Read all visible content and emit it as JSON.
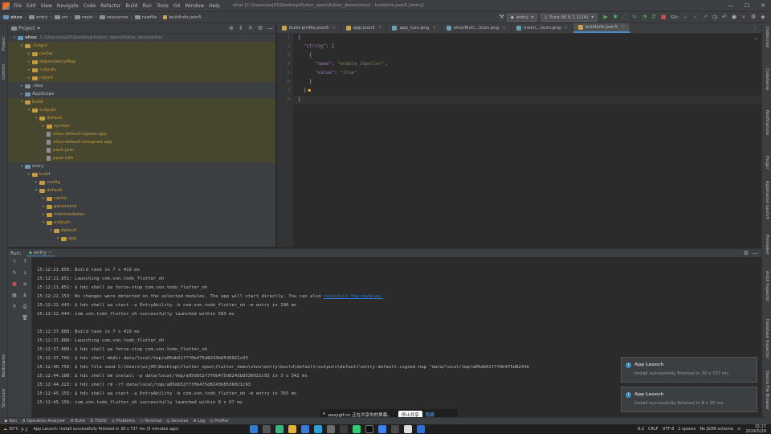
{
  "menubar": {
    "items": [
      "File",
      "Edit",
      "View",
      "Navigate",
      "Code",
      "Refactor",
      "Build",
      "Run",
      "Tools",
      "Git",
      "Window",
      "Help"
    ],
    "title": "ohos [C:\\Users\\wsj05\\Desktop\\flutter_open\\flutter_demo\\ohos] - buildinfo.json5 [entry]"
  },
  "breadcrumb": [
    "ohos",
    "entry",
    "src",
    "main",
    "resources",
    "rawfile",
    "buildinfo.json5"
  ],
  "toolbar": {
    "module": "entry",
    "device": "Pura 90 6.1.1(24)",
    "git_label": "Git:"
  },
  "project": {
    "header": "Project",
    "root_name": "ohos",
    "root_path": "C:\\Users\\wsj05\\Desktop\\flutter_open\\flutter_demo\\ohos",
    "tree": [
      {
        "label": ".hvigor",
        "level": 1,
        "kind": "folder-o",
        "arrow": "▾",
        "ex": true
      },
      {
        "label": "cache",
        "level": 2,
        "kind": "folder-o",
        "arrow": "▸",
        "ex": true
      },
      {
        "label": "dependencyMap",
        "level": 2,
        "kind": "folder-o",
        "arrow": "▸",
        "ex": true
      },
      {
        "label": "outputs",
        "level": 2,
        "kind": "folder-o",
        "arrow": "▸",
        "ex": true
      },
      {
        "label": "report",
        "level": 2,
        "kind": "folder-o",
        "arrow": "▸",
        "ex": true
      },
      {
        "label": ".idea",
        "level": 1,
        "kind": "folder",
        "arrow": "▸",
        "ex": false
      },
      {
        "label": "AppScope",
        "level": 1,
        "kind": "folder-n",
        "arrow": "▸",
        "ex": false
      },
      {
        "label": "build",
        "level": 1,
        "kind": "folder-o",
        "arrow": "▾",
        "ex": true
      },
      {
        "label": "outputs",
        "level": 2,
        "kind": "folder-o",
        "arrow": "▾",
        "ex": true
      },
      {
        "label": "default",
        "level": 3,
        "kind": "folder-o",
        "arrow": "▾",
        "ex": true
      },
      {
        "label": "symbol",
        "level": 4,
        "kind": "folder-o",
        "arrow": "▸",
        "ex": true
      },
      {
        "label": "ohos-default-signed.app",
        "level": 4,
        "kind": "file-o",
        "arrow": "",
        "ex": true
      },
      {
        "label": "ohos-default-unsigned.app",
        "level": 4,
        "kind": "file-o",
        "arrow": "",
        "ex": true
      },
      {
        "label": "pack.json",
        "level": 4,
        "kind": "file-o",
        "arrow": "",
        "ex": true
      },
      {
        "label": "pack.info",
        "level": 4,
        "kind": "file-o",
        "arrow": "",
        "ex": true
      },
      {
        "label": "entry",
        "level": 1,
        "kind": "folder-n",
        "arrow": "▾",
        "ex": false
      },
      {
        "label": "build",
        "level": 2,
        "kind": "folder-o",
        "arrow": "▾",
        "ex": false
      },
      {
        "label": "config",
        "level": 3,
        "kind": "folder-o",
        "arrow": "▸",
        "ex": false
      },
      {
        "label": "default",
        "level": 3,
        "kind": "folder-o",
        "arrow": "▾",
        "ex": false
      },
      {
        "label": "cache",
        "level": 4,
        "kind": "folder-o",
        "arrow": "▸",
        "ex": false
      },
      {
        "label": "generated",
        "level": 4,
        "kind": "folder-o",
        "arrow": "▸",
        "ex": false
      },
      {
        "label": "intermediates",
        "level": 4,
        "kind": "folder-o",
        "arrow": "▸",
        "ex": false
      },
      {
        "label": "outputs",
        "level": 4,
        "kind": "folder-o",
        "arrow": "▾",
        "ex": false
      },
      {
        "label": "default",
        "level": 5,
        "kind": "folder-o",
        "arrow": "▾",
        "ex": false
      },
      {
        "label": "app",
        "level": 6,
        "kind": "folder-o",
        "arrow": "▾",
        "ex": false
      }
    ]
  },
  "editor": {
    "tabs": [
      {
        "label": "build-profile.json5",
        "color": "#c9a44a",
        "active": false
      },
      {
        "label": "app.json5",
        "color": "#c9a44a",
        "active": false
      },
      {
        "label": "app_icon.png",
        "color": "#6a9fb5",
        "active": false
      },
      {
        "label": "ohosTest\\...\\icon.png",
        "color": "#6a9fb5",
        "active": false
      },
      {
        "label": "main\\...\\icon.png",
        "color": "#6a9fb5",
        "active": false
      },
      {
        "label": "buildinfo.json5",
        "color": "#c9a44a",
        "active": true
      }
    ],
    "line_numbers": [
      "1",
      "2",
      "3",
      "4",
      "5",
      "6",
      "7",
      "8"
    ],
    "code": {
      "l1": "{",
      "l2a": "  ",
      "l2k": "\"string\"",
      "l2b": ": [",
      "l3": "    {",
      "l4a": "      ",
      "l4k": "\"name\"",
      "l4b": ": ",
      "l4v": "\"enable_impeller\"",
      "l4c": ",",
      "l5a": "      ",
      "l5k": "\"value\"",
      "l5b": ": ",
      "l5v": "\"true\"",
      "l6": "    }",
      "l7": "  ]",
      "l8": "}"
    }
  },
  "run": {
    "label": "Run:",
    "tab": "entry",
    "lines": [
      "15:12:21.850: Build task in 7 s 419 ms",
      "15:12:21.851: Launching com.von.todo_flutter_oh",
      "15:12:21.851: $ hdc shell aa force-stop com.von.todo_flutter_oh",
      "15:12:22.153: No changes were detected on the selected modules. The app will start directly. You can also ",
      "15:12:22.443: $ hdc shell aa start -a EntryAbility -b com.von.todo_flutter_oh -m entry in 290 ms",
      "15:12:22.444: com.von.todo_flutter_oh successfully launched within 593 ms",
      "",
      "15:12:37.889: Build task in 7 s 419 ms",
      "15:12:37.889: Launching com.von.todo_flutter_oh",
      "15:12:37.889: $ hdc shell aa force-stop com.von.todo_flutter_oh",
      "15:12:37.766: $ hdc shell mkdir data/local/tmp/a05db52f7f0b475d8243b8536021c93",
      "15:12:40.750: $ hdc file send C:\\Users\\wsj05\\Desktop\\flutter_open\\flutter_demo\\ohos\\entry\\build\\default\\outputs\\default\\entry-default-signed.hap \"data/local/tmp/a05db52f7f0b475d8243b",
      "15:12:44.180: $ hdc shell bm install -p data/local/tmp/a05db52f7f0b475d8243b8536021c93 in 3 s 342 ms",
      "15:12:44.223: $ hdc shell rm -rf data/local/tmp/a05db52f7f0b475d8243b8536021c93",
      "15:12:45.155: $ hdc shell aa start -a EntryAbility -b com.von.todo_flutter_oh -m entry in 765 ms",
      "15:12:45.156: com.von.todo_flutter_oh successfully launched within 8 s 67 ms"
    ],
    "link": "reinstall the modules.",
    "link_tail": "."
  },
  "notifications": [
    {
      "title": "App Launch",
      "body": "Install successfully finished in 30 s 737 ms"
    },
    {
      "title": "App Launch",
      "body": "Install successfully finished in 8 s 25 ms"
    }
  ],
  "left_tabs": [
    "Project",
    "Commit",
    "Bookmarks",
    "Structure"
  ],
  "right_tabs": [
    "CodeLinter",
    "CodeGenie",
    "Notifications",
    "Hvigor",
    "Application Launch",
    "Previewer",
    "ArkUI Inspector",
    "Database Inspector",
    "Device File Browser"
  ],
  "toolwindows": [
    "Run",
    "Operation Analyzer",
    "Build",
    "TODO",
    "Problems",
    "Terminal",
    "Services",
    "Log",
    "Profiler"
  ],
  "status": {
    "weather": "30°C",
    "weather_desc": "多云",
    "message": "App Launch: Install successfully finished in 30 s 737 ms (5 minutes ago)",
    "position": "8:2",
    "line_sep": "CRLF",
    "encoding": "UTF-8",
    "indent": "2 spaces",
    "schema": "No JSON schema",
    "time": "15:17",
    "date": "2024/5/29"
  },
  "share_bar": {
    "text": "easygif.cn 正在共享你的屏幕。",
    "stop": "停止共享",
    "hide": "隐藏"
  }
}
